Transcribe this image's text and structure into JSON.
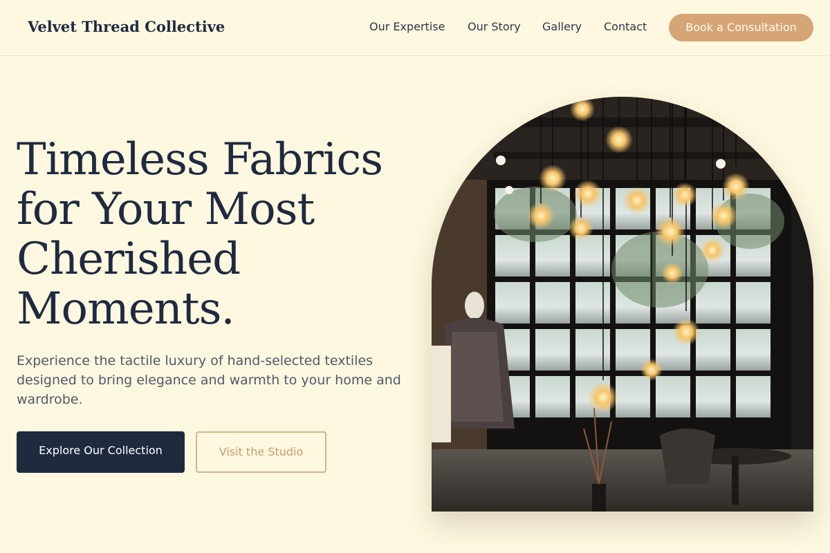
{
  "brand": {
    "name": "Velvet Thread Collective"
  },
  "nav": {
    "items": [
      {
        "label": "Our Expertise"
      },
      {
        "label": "Our Story"
      },
      {
        "label": "Gallery"
      },
      {
        "label": "Contact"
      }
    ],
    "cta_label": "Book a Consultation"
  },
  "hero": {
    "title": "Timeless Fabrics for Your Most Cherished Moments.",
    "subtitle": "Experience the tactile luxury of hand-selected textiles designed to bring elegance and warmth to your home and wardrobe.",
    "primary_button": "Explore Our Collection",
    "secondary_button": "Visit the Studio"
  },
  "colors": {
    "background": "#fef8e0",
    "navy": "#1f2a3f",
    "accent": "#d6a577"
  }
}
